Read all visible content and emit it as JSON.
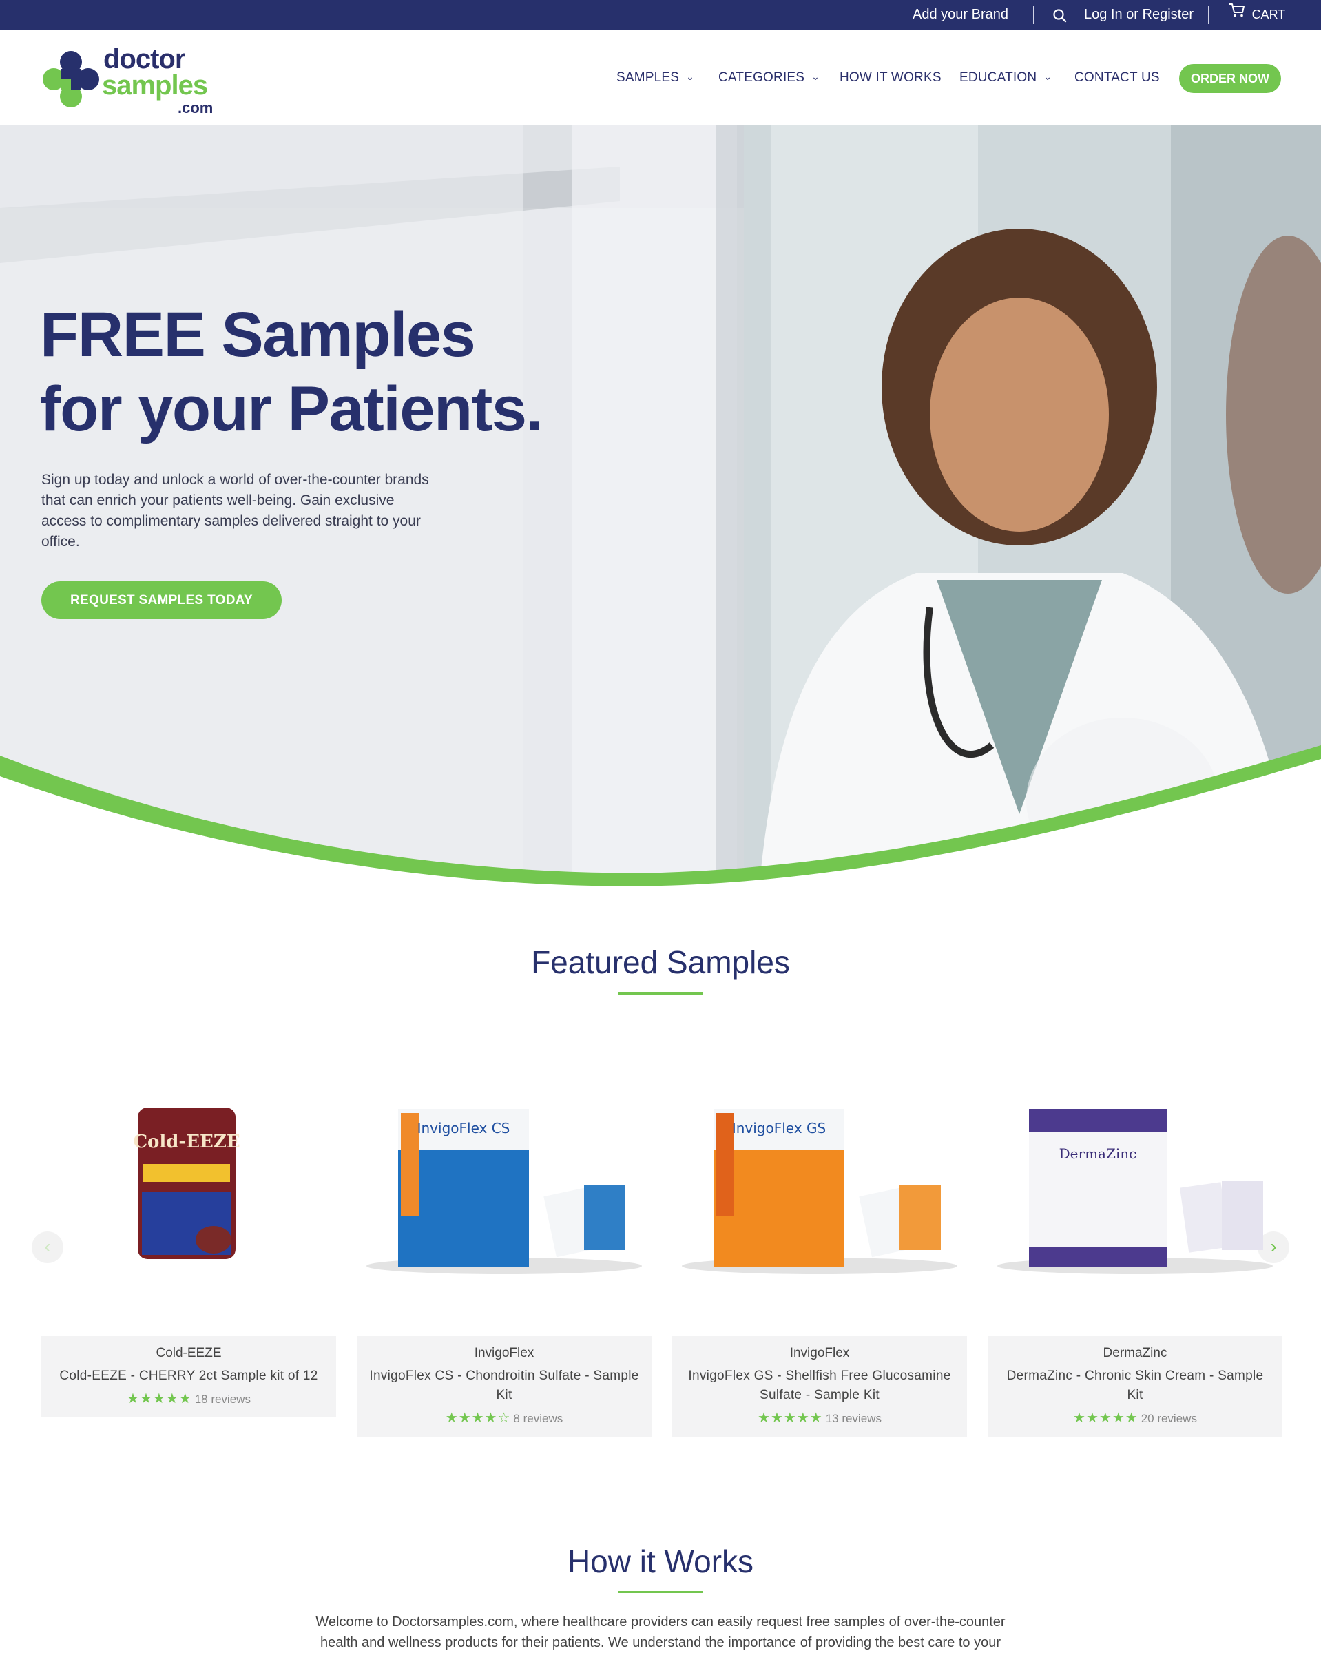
{
  "topbar": {
    "add_brand": "Add your Brand",
    "login": "Log In or Register",
    "cart": "CART"
  },
  "header": {
    "logo_line1": "doctor",
    "logo_line2": "samples",
    "logo_line3": ".com",
    "nav": [
      {
        "label": "SAMPLES",
        "dropdown": true
      },
      {
        "label": "CATEGORIES",
        "dropdown": true
      },
      {
        "label": "HOW IT WORKS",
        "dropdown": false
      },
      {
        "label": "EDUCATION",
        "dropdown": true
      },
      {
        "label": "CONTACT US",
        "dropdown": false
      }
    ],
    "order_button": "ORDER NOW"
  },
  "hero": {
    "title_line1": "FREE Samples",
    "title_line2": "for your Patients.",
    "text": "Sign up today and unlock a world of over-the-counter brands that can enrich your patients well-being. Gain exclusive access to complimentary samples delivered straight to your office.",
    "button": "REQUEST SAMPLES TODAY"
  },
  "featured": {
    "title": "Featured Samples",
    "products": [
      {
        "brand": "Cold-EEZE",
        "name": "Cold-EEZE - CHERRY 2ct Sample kit of 12",
        "stars": "★★★★★",
        "reviews": "18 reviews",
        "image_label": "Cold-EEZE"
      },
      {
        "brand": "InvigoFlex",
        "name": "InvigoFlex CS - Chondroitin Sulfate - Sample Kit",
        "stars": "★★★★☆",
        "reviews": "8 reviews",
        "image_label": "InvigoFlex CS"
      },
      {
        "brand": "InvigoFlex",
        "name": "InvigoFlex GS - Shellfish Free Glucosamine Sulfate - Sample Kit",
        "stars": "★★★★★",
        "reviews": "13 reviews",
        "image_label": "InvigoFlex GS"
      },
      {
        "brand": "DermaZinc",
        "name": "DermaZinc - Chronic Skin Cream - Sample Kit",
        "stars": "★★★★★",
        "reviews": "20 reviews",
        "image_label": "DermaZinc"
      }
    ]
  },
  "how_it_works": {
    "title": "How it Works",
    "text": "Welcome to Doctorsamples.com, where healthcare providers can easily request free samples of over-the-counter health and wellness products for their patients. We understand the importance of providing the best care to your"
  },
  "colors": {
    "navy": "#27306c",
    "green": "#73c64f"
  },
  "icons": [
    "search-icon",
    "cart-icon",
    "chevron-down-icon",
    "chevron-left-icon",
    "chevron-right-icon"
  ]
}
